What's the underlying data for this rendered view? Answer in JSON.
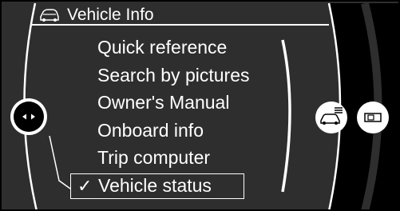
{
  "header": {
    "title": "Vehicle Info",
    "icon": "car-info-icon"
  },
  "menu": {
    "items": [
      {
        "label": "Quick reference",
        "selected": false
      },
      {
        "label": "Search by pictures",
        "selected": false
      },
      {
        "label": "Owner's Manual",
        "selected": false
      },
      {
        "label": "Onboard info",
        "selected": false
      },
      {
        "label": "Trip computer",
        "selected": false
      },
      {
        "label": "Vehicle status",
        "selected": true
      }
    ],
    "selected_marker": "✓"
  },
  "controls": {
    "left_knob_icon": "left-right-arrows-icon",
    "car_settings_icon": "car-menu-icon",
    "display_icon": "screen-display-icon"
  },
  "colors": {
    "background": "#2e2e2e",
    "text": "#ffffff",
    "frame": "#000000",
    "knob": "#ffffff"
  }
}
